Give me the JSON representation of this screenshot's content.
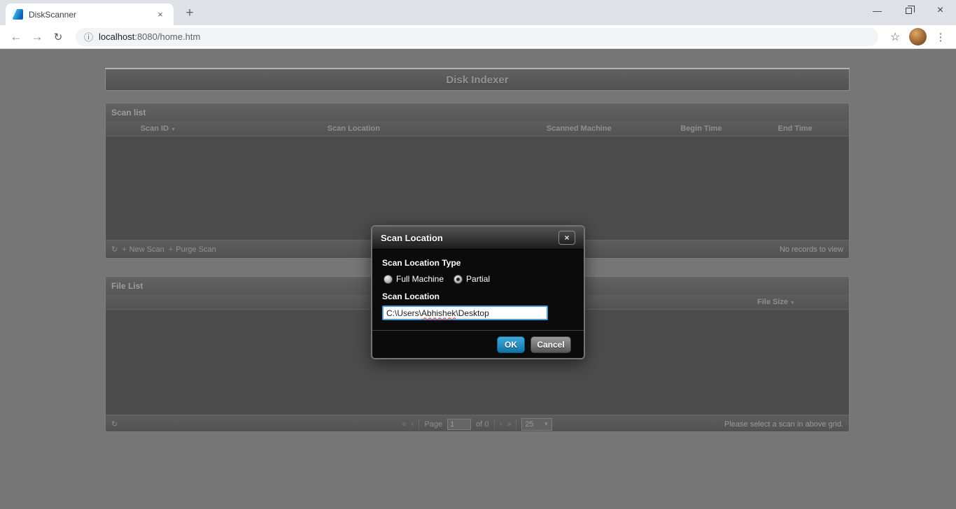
{
  "browser": {
    "tab_title": "DiskScanner",
    "url_host": "localhost",
    "url_rest": ":8080/home.htm"
  },
  "icons": {
    "tab_close": "×",
    "new_tab": "+",
    "minimize": "—",
    "window_close": "×",
    "back": "←",
    "forward": "→",
    "reload": "↻",
    "info": "ⓘ",
    "star": "☆",
    "menu": "⋮",
    "sort_desc": "▼",
    "refresh": "↻",
    "new_scan": "+",
    "purge_scan": "+",
    "pager_first": "«",
    "pager_prev": "‹",
    "pager_next": "›",
    "pager_last": "»",
    "select_caret": "▼",
    "dialog_close": "×"
  },
  "page": {
    "title": "Disk Indexer"
  },
  "scan_grid": {
    "caption": "Scan list",
    "columns": [
      "Scan ID",
      "Scan Location",
      "Scanned Machine",
      "Begin Time",
      "End Time"
    ],
    "toolbar": {
      "new_scan": "New Scan",
      "purge_scan": "Purge Scan"
    },
    "status": "No records to view"
  },
  "file_grid": {
    "caption": "File List",
    "file_size_column": "File Size",
    "pager": {
      "page_label": "Page",
      "page_value": "1",
      "of_label": "of 0",
      "page_size": "25"
    },
    "status": "Please select a scan in above grid."
  },
  "dialog": {
    "title": "Scan Location",
    "type_label": "Scan Location Type",
    "option_full": "Full Machine",
    "option_partial": "Partial",
    "selected_option": "Partial",
    "location_label": "Scan Location",
    "location_prefix": "C:\\Users\\",
    "location_misspelled": "Abhishek",
    "location_suffix": "\\Desktop",
    "ok_label": "OK",
    "cancel_label": "Cancel"
  },
  "colors": {
    "overlay_gray": "#767676",
    "grid_body": "#4c4c4c",
    "ok_button_blue": "#1b86b5",
    "input_focus_border": "#4f9fd8",
    "spellcheck_red": "#e03c31"
  }
}
